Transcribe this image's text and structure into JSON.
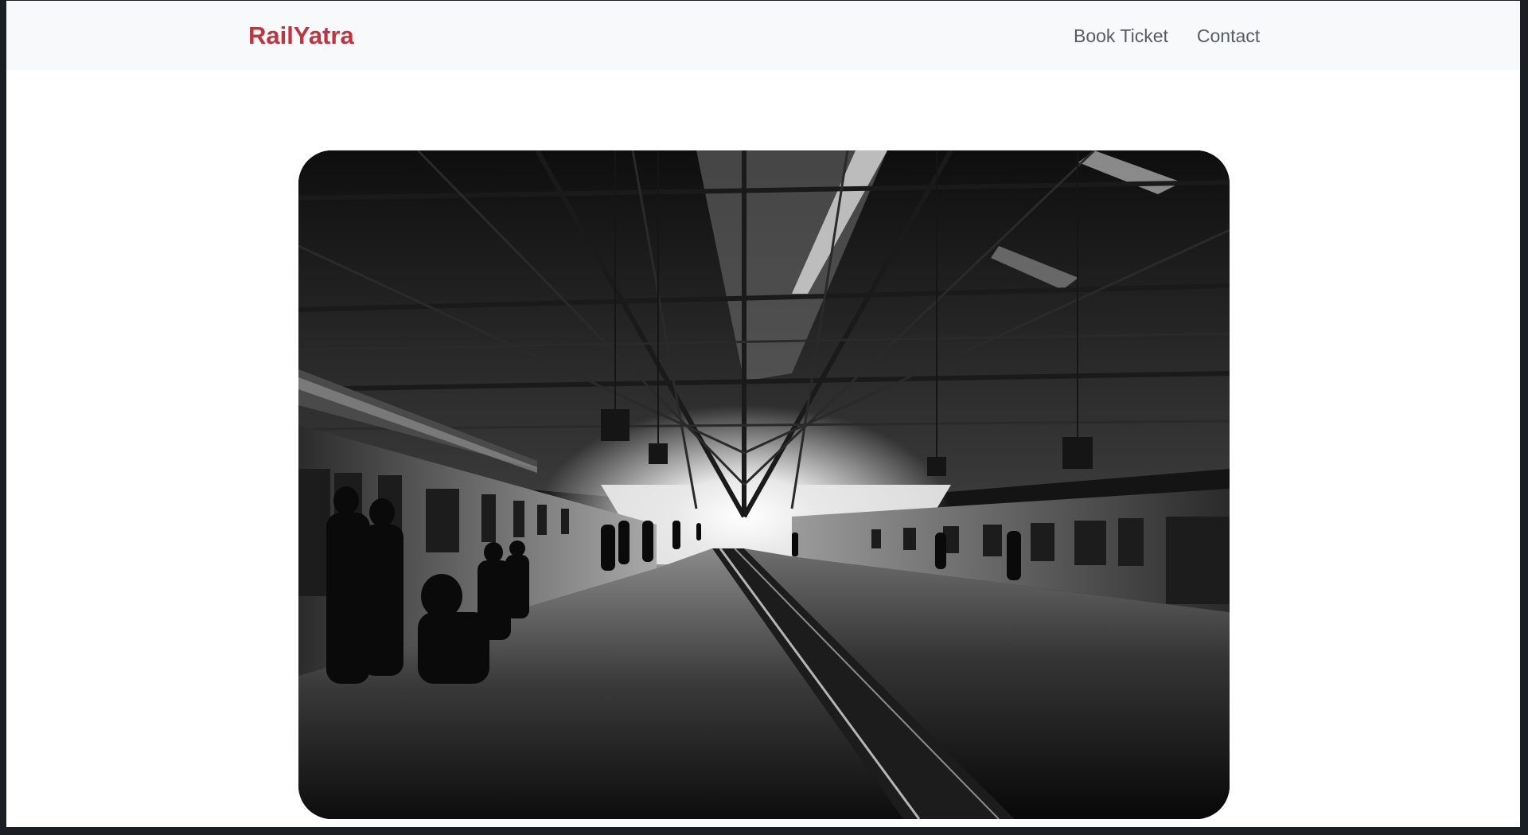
{
  "navbar": {
    "brand": "RailYatra",
    "links": [
      {
        "label": "Book Ticket"
      },
      {
        "label": "Contact"
      }
    ]
  },
  "hero": {
    "image_description_icon": "railway-station-platform-photo"
  },
  "colors": {
    "brand": "#c0353d",
    "navbar_bg": "#f8f9fa",
    "nav_link": "#555c63",
    "frame": "#1b1f23"
  }
}
